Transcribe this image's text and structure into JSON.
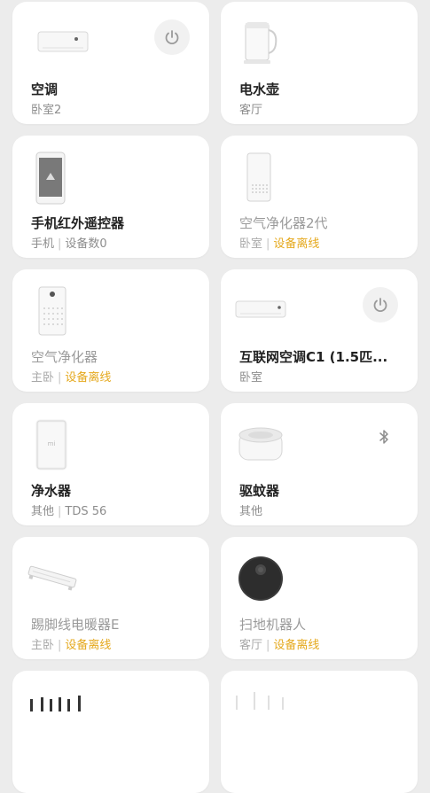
{
  "devices": [
    {
      "name": "空调",
      "room": "卧室2"
    },
    {
      "name": "电水壶",
      "room": "客厅"
    },
    {
      "name": "手机红外遥控器",
      "room": "手机",
      "extra": "设备数0"
    },
    {
      "name": "空气净化器2代",
      "room": "卧室",
      "status": "设备离线"
    },
    {
      "name": "空气净化器",
      "room": "主卧",
      "status": "设备离线"
    },
    {
      "name": "互联网空调C1 (1.5匹...",
      "room": "卧室"
    },
    {
      "name": "净水器",
      "room": "其他",
      "extra": "TDS 56"
    },
    {
      "name": "驱蚊器",
      "room": "其他"
    },
    {
      "name": "踢脚线电暖器E",
      "room": "主卧",
      "status": "设备离线"
    },
    {
      "name": "扫地机器人",
      "room": "客厅",
      "status": "设备离线"
    }
  ],
  "separator": "|",
  "icons": {
    "power": "power-icon",
    "bluetooth": "bluetooth-icon"
  },
  "colors": {
    "offline_status": "#e5a91e",
    "card_bg": "#ffffff",
    "page_bg": "#ececec"
  }
}
